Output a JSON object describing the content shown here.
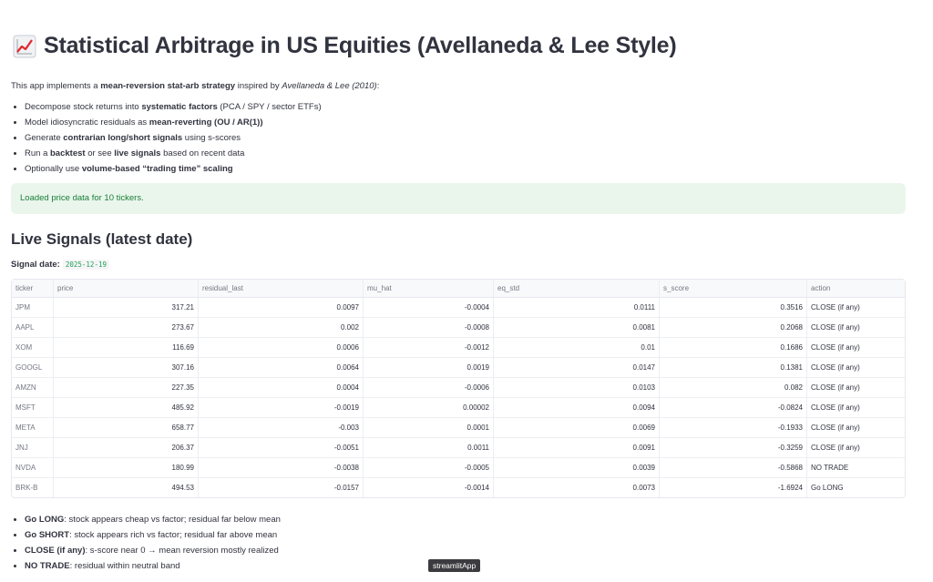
{
  "header": {
    "title": "Statistical Arbitrage in US Equities (Avellaneda & Lee Style)",
    "emoji_icon": "chart-increasing-icon"
  },
  "intro": {
    "prefix": "This app implements a ",
    "strategy": "mean-reversion stat-arb strategy",
    "middle": " inspired by ",
    "citation": "Avellaneda & Lee (2010)",
    "suffix": ":"
  },
  "bullets": [
    {
      "pre": "Decompose stock returns into ",
      "bold": "systematic factors",
      "post": " (PCA / SPY / sector ETFs)"
    },
    {
      "pre": "Model idiosyncratic residuals as ",
      "bold": "mean-reverting (OU / AR(1))",
      "post": ""
    },
    {
      "pre": "Generate ",
      "bold": "contrarian long/short signals",
      "post": " using s-scores"
    },
    {
      "pre": "Run a ",
      "bold": "backtest",
      "post": " or see ",
      "bold2": "live signals",
      "post2": " based on recent data"
    },
    {
      "pre": "Optionally use ",
      "bold": "volume-based “trading time” scaling",
      "post": ""
    }
  ],
  "alert": {
    "text": "Loaded price data for 10 tickers."
  },
  "section": {
    "heading": "Live Signals (latest date)"
  },
  "signal_date": {
    "label": "Signal date:",
    "value": "2025-12-19"
  },
  "table": {
    "columns": [
      "ticker",
      "price",
      "residual_last",
      "mu_hat",
      "eq_std",
      "s_score",
      "action"
    ],
    "rows": [
      [
        "JPM",
        "317.21",
        "0.0097",
        "-0.0004",
        "0.0111",
        "0.3516",
        "CLOSE (if any)"
      ],
      [
        "AAPL",
        "273.67",
        "0.002",
        "-0.0008",
        "0.0081",
        "0.2068",
        "CLOSE (if any)"
      ],
      [
        "XOM",
        "116.69",
        "0.0006",
        "-0.0012",
        "0.01",
        "0.1686",
        "CLOSE (if any)"
      ],
      [
        "GOOGL",
        "307.16",
        "0.0064",
        "0.0019",
        "0.0147",
        "0.1381",
        "CLOSE (if any)"
      ],
      [
        "AMZN",
        "227.35",
        "0.0004",
        "-0.0006",
        "0.0103",
        "0.082",
        "CLOSE (if any)"
      ],
      [
        "MSFT",
        "485.92",
        "-0.0019",
        "0.00002",
        "0.0094",
        "-0.0824",
        "CLOSE (if any)"
      ],
      [
        "META",
        "658.77",
        "-0.003",
        "0.0001",
        "0.0069",
        "-0.1933",
        "CLOSE (if any)"
      ],
      [
        "JNJ",
        "206.37",
        "-0.0051",
        "0.0011",
        "0.0091",
        "-0.3259",
        "CLOSE (if any)"
      ],
      [
        "NVDA",
        "180.99",
        "-0.0038",
        "-0.0005",
        "0.0039",
        "-0.5868",
        "NO TRADE"
      ],
      [
        "BRK-B",
        "494.53",
        "-0.0157",
        "-0.0014",
        "0.0073",
        "-1.6924",
        "Go LONG"
      ]
    ]
  },
  "legend": [
    {
      "bold": "Go LONG",
      "text": ": stock appears cheap vs factor; residual far below mean"
    },
    {
      "bold": "Go SHORT",
      "text": ": stock appears rich vs factor; residual far above mean"
    },
    {
      "bold": "CLOSE (if any)",
      "text": ": s-score near 0 → mean reversion mostly realized"
    },
    {
      "bold": "NO TRADE",
      "text": ": residual within neutral band"
    }
  ],
  "tooltip": {
    "text": "streamlitApp"
  },
  "colors": {
    "success_bg": "#eaf6ec",
    "success_text": "#1a7f37",
    "code_text": "#21a05a"
  }
}
